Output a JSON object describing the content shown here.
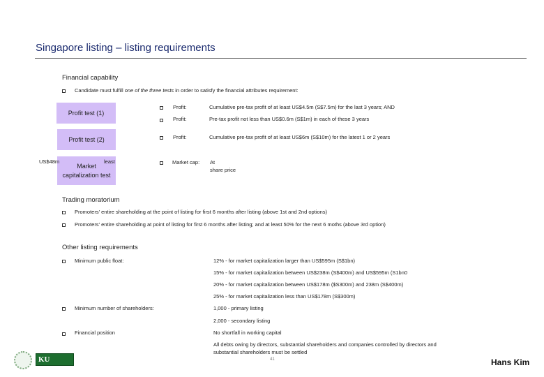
{
  "title": "Singapore listing – listing requirements",
  "financial": {
    "heading": "Financial capability",
    "intro_pre": "Candidate must fulfill ",
    "intro_italic": "one of the three tests",
    "intro_post": " in order to satisfy the financial attributes requirement:",
    "tests": [
      {
        "label": "Profit test (1)",
        "items": [
          {
            "key": "Profit:",
            "value": "Cumulative pre-tax profit of at least US$4.5m (S$7.5m) for the last 3 years; AND"
          },
          {
            "key": "Profit:",
            "value": "Pre-tax profit not less than US$0.6m (S$1m) in each of these 3 years"
          }
        ]
      },
      {
        "label": "Profit test (2)",
        "items": [
          {
            "key": "Profit:",
            "value": "Cumulative pre-tax profit of at least US$6m (S$10m) for the latest 1 or 2 years"
          }
        ]
      },
      {
        "label": "Market capitalization test",
        "items": [
          {
            "key": "Market cap:",
            "value": "At",
            "value2": "share price"
          }
        ],
        "overflow_left": "US$48m",
        "overflow_right": "least"
      }
    ]
  },
  "moratorium": {
    "heading": "Trading moratorium",
    "items": [
      "Promoters' entire shareholding at the point of listing for first 6 months after listing (above 1st and 2nd options)",
      "Promoters' entire shareholding at point of listing for first 6 months after listing; and at least 50% for the next 6 moths (above 3rd option)"
    ]
  },
  "other": {
    "heading": "Other listing requirements",
    "float_label": "Minimum public float:",
    "float_values": [
      "12% - for market capitalization larger than US$595m (S$1bn)",
      "15% - for market capitalization between US$238m (S$400m) and US$595m (S1bn0",
      "20% - for market capitalization between US$178m ($S300m) and 238m (S$400m)",
      "25% - for market capitalization less than US$178m (S$300m)"
    ],
    "holders_label": "Minimum number of shareholders:",
    "holders_values": [
      "1,000 - primary listing",
      "2,000 - secondary listing"
    ],
    "position_label": "Financial position",
    "position_values": [
      "No shortfall in working capital",
      "All debts owing by directors, substantial shareholders and companies controlled by directors and",
      "substantial shareholders must be settled"
    ]
  },
  "footer": {
    "page": "41",
    "author": "Hans Kim",
    "logo": "KU KONKUK UNIVERSITY"
  }
}
